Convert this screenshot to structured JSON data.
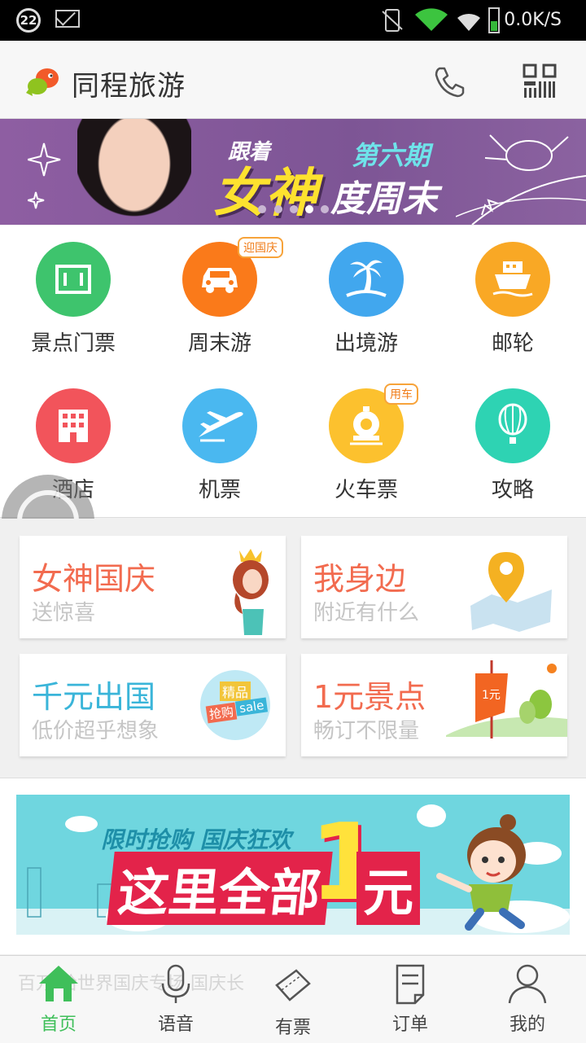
{
  "statusbar": {
    "notification_count": "22",
    "net_speed": "0.0K/S"
  },
  "header": {
    "title": "同程旅游"
  },
  "banner": {
    "line1": "跟着",
    "big_text": "女神",
    "line2": "第六期",
    "line3": "度周末",
    "dots_total": 5,
    "dots_active_index": 4
  },
  "grid": [
    {
      "label": "景点门票",
      "icon": "ticket-icon",
      "color": "#3ec46d"
    },
    {
      "label": "周末游",
      "icon": "car-icon",
      "color": "#fa7a1a",
      "tag": "迎国庆"
    },
    {
      "label": "出境游",
      "icon": "palm-tree-icon",
      "color": "#41a7ee"
    },
    {
      "label": "邮轮",
      "icon": "ship-icon",
      "color": "#f9a825"
    },
    {
      "label": "酒店",
      "icon": "hotel-icon",
      "color": "#f2545b"
    },
    {
      "label": "机票",
      "icon": "plane-icon",
      "color": "#4ab8f0"
    },
    {
      "label": "火车票",
      "icon": "train-icon",
      "color": "#fcc12e",
      "tag": "用车"
    },
    {
      "label": "攻略",
      "icon": "balloon-icon",
      "color": "#2ed3b3"
    }
  ],
  "cards": [
    {
      "title": "女神国庆",
      "sub": "送惊喜",
      "color": "#f26b4f",
      "icon": "goddess-icon"
    },
    {
      "title": "我身边",
      "sub": "附近有什么",
      "color": "#f26b4f",
      "icon": "map-pin-icon"
    },
    {
      "title": "千元出国",
      "sub": "低价超乎想象",
      "color": "#3ab5d9",
      "icon": "sale-badge-icon",
      "badge_top": "精品",
      "badge_mid": "抢购",
      "badge_sale": "sale"
    },
    {
      "title": "1元景点",
      "sub": "畅订不限量",
      "color": "#f26b4f",
      "icon": "flag-icon",
      "flag_text": "1元"
    }
  ],
  "promo": {
    "top_text": "限时抢购 国庆狂欢",
    "main_text": "这里全部",
    "big_num": "1",
    "suffix": "元"
  },
  "tabbar": {
    "ghost_text": "百万 恰世界国庆专场   国庆长",
    "tabs": [
      {
        "label": "首页",
        "icon": "home-icon",
        "active": true
      },
      {
        "label": "语音",
        "icon": "microphone-icon",
        "active": false
      },
      {
        "label": "有票",
        "icon": "ticket-stub-icon",
        "active": false
      },
      {
        "label": "订单",
        "icon": "order-icon",
        "active": false
      },
      {
        "label": "我的",
        "icon": "user-icon",
        "active": false
      }
    ]
  },
  "colors": {
    "accent_green": "#3fbf5a",
    "banner_purple": "#8a5c9e"
  }
}
